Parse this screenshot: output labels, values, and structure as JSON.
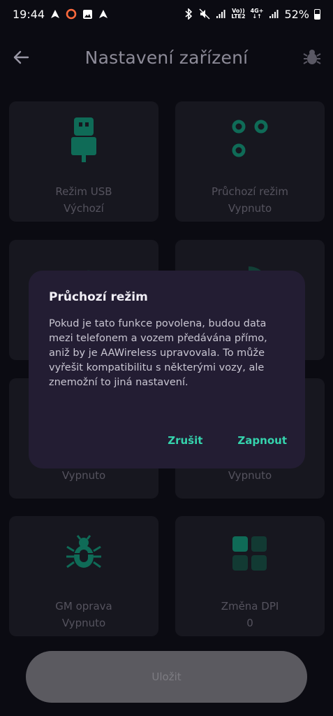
{
  "status_bar": {
    "time": "19:44",
    "network_top": "Vo))",
    "network_bottom": "LTE2",
    "gen_top": "4G+",
    "gen_bottom": "↓↑",
    "battery": "52%"
  },
  "header": {
    "title": "Nastavení zařízení"
  },
  "tiles": [
    {
      "label": "Režim USB",
      "value": "Výchozí"
    },
    {
      "label": "Průchozí režim",
      "value": "Vypnuto"
    },
    {
      "label": "",
      "value": ""
    },
    {
      "label": "",
      "value": ""
    },
    {
      "label": "",
      "value": "Vypnuto"
    },
    {
      "label": "",
      "value": "Vypnuto"
    },
    {
      "label": "GM oprava",
      "value": "Vypnuto"
    },
    {
      "label": "Změna DPI",
      "value": "0"
    }
  ],
  "dialog": {
    "title": "Průchozí režim",
    "body": "Pokud je tato funkce povolena, budou data mezi telefonem a vozem předávána přímo, aniž by je AAWireless upravovala. To může vyřešit kompatibilitu s některými vozy, ale znemožní to jiná nastavení.",
    "cancel_label": "Zrušit",
    "confirm_label": "Zapnout"
  },
  "save_button": {
    "label": "Uložit"
  },
  "colors": {
    "accent": "#35d3ad",
    "dim_accent": "#0f6b57",
    "dialog_bg": "#231d33",
    "tile_bg": "#17171f"
  }
}
